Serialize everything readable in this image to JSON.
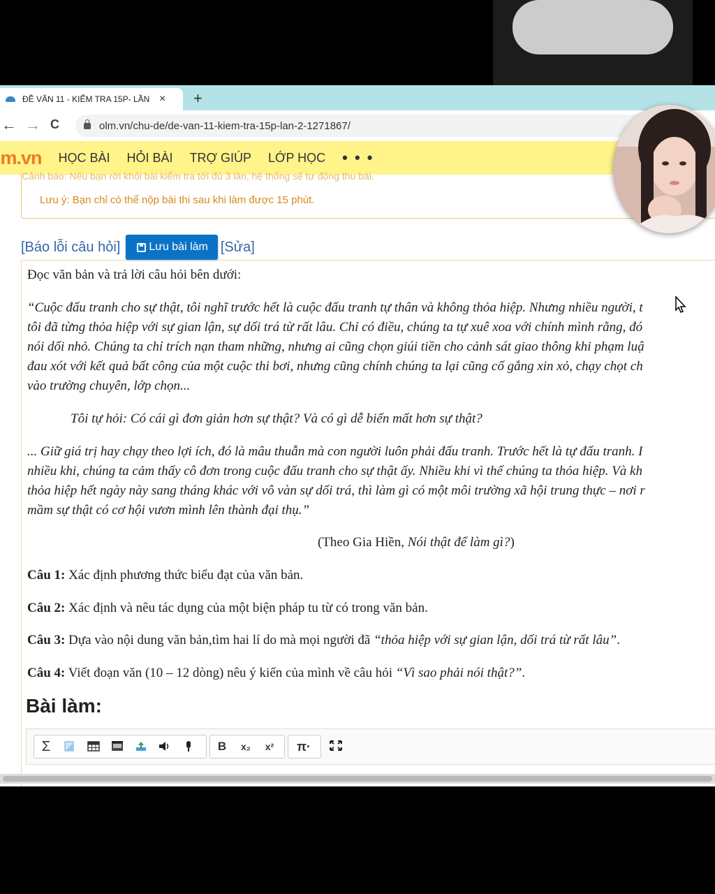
{
  "browser": {
    "tab_title": "ĐỀ VĂN 11 - KIỂM TRA 15P- LẦN",
    "tab_close": "×",
    "new_tab": "+",
    "back": "←",
    "forward": "→",
    "reload": "C",
    "url": "olm.vn/chu-de/de-van-11-kiem-tra-15p-lan-2-1271867/"
  },
  "site": {
    "logo": "lm.vn",
    "nav": [
      "HỌC BÀI",
      "HỎI BÀI",
      "TRỢ GIÚP",
      "LỚP HỌC"
    ],
    "more": "• • •"
  },
  "notice": {
    "cut_line": "Cảnh báo: Nếu bạn rời khỏi bài kiểm tra tới đủ 3 lần, hệ thống sẽ tự động thu bài.",
    "note": "Lưu ý: Bạn chỉ có thể nộp bài thi sau khi làm được 15 phút."
  },
  "actions": {
    "report": "[Báo lỗi câu hỏi]",
    "save": "Lưu bài làm",
    "edit": "[Sửa]"
  },
  "content": {
    "intro": "Đọc văn bản và trả lời câu hỏi bên dưới:",
    "p1": [
      "“Cuộc đấu tranh cho sự thật, tôi nghĩ trước hết là cuộc đấu tranh tự thân và không thỏa hiệp. Nhưng nhiều người, t",
      "tôi đã từng thỏa hiệp với sự gian lận, sự dối trá từ rất lâu. Chỉ có điều, chúng ta tự xuê xoa với chính mình rằng, đó",
      "nói dối nhỏ. Chúng ta chỉ trích nạn tham những, nhưng ai cũng chọn giúi tiền cho cảnh sát giao thông khi phạm luậ",
      "đau xót với kết quả bất công của một cuộc thi bơi, nhưng cũng chính chúng ta lại cũng cố gắng xin xỏ, chạy chọt ch",
      "vào trường chuyên, lớp chọn..."
    ],
    "p2": "Tôi tự hỏi: Có cái gì đơn giản hơn sự thật? Và có gì dễ biến mất hơn sự thật?",
    "p3": [
      "... Giữ giá trị hay chạy theo lợi ích, đó là mâu thuẫn mà con người luôn phải đấu tranh. Trước hết là tự đấu tranh. I",
      "nhiều khi, chúng ta cảm thấy cô đơn trong cuộc đấu tranh cho sự thật ấy. Nhiều khi vì thế chúng ta thỏa hiệp. Và kh",
      "thỏa hiệp hết ngày này sang tháng khác với vô vàn sự dối trá, thì làm gì có một môi trường xã hội trung thực – nơi r",
      "mầm sự thật có cơ hội vươn mình lên thành đại thụ.”"
    ],
    "source_prefix": "(Theo Gia Hiền, ",
    "source_title": "Nói thật để làm gì?",
    "source_suffix": ")",
    "questions": [
      {
        "label": "Câu 1:",
        "text": " Xác định phương thức biểu đạt của văn bản.",
        "quote": "",
        "tail": ""
      },
      {
        "label": "Câu 2:",
        "text": " Xác định và nêu tác dụng của một biện pháp tu từ có trong văn bản.",
        "quote": "",
        "tail": ""
      },
      {
        "label": "Câu 3:",
        "text": " Dựa vào nội dung văn bản,tìm hai lí do mà mọi người đã ",
        "quote": "“thỏa hiệp với sự gian lận, dối trá từ rất lâu”",
        "tail": "."
      },
      {
        "label": "Câu 4:",
        "text": " Viết đoạn văn (10 – 12 dòng)  nêu ý kiến của mình về câu hỏi ",
        "quote": "“Vì sao phải nói thật?”",
        "tail": "."
      }
    ],
    "answer_title": "Bài làm:"
  },
  "toolbar": {
    "sigma": "Σ",
    "bold": "B",
    "sub": "x₂",
    "sup": "x²",
    "pi": "π·"
  }
}
